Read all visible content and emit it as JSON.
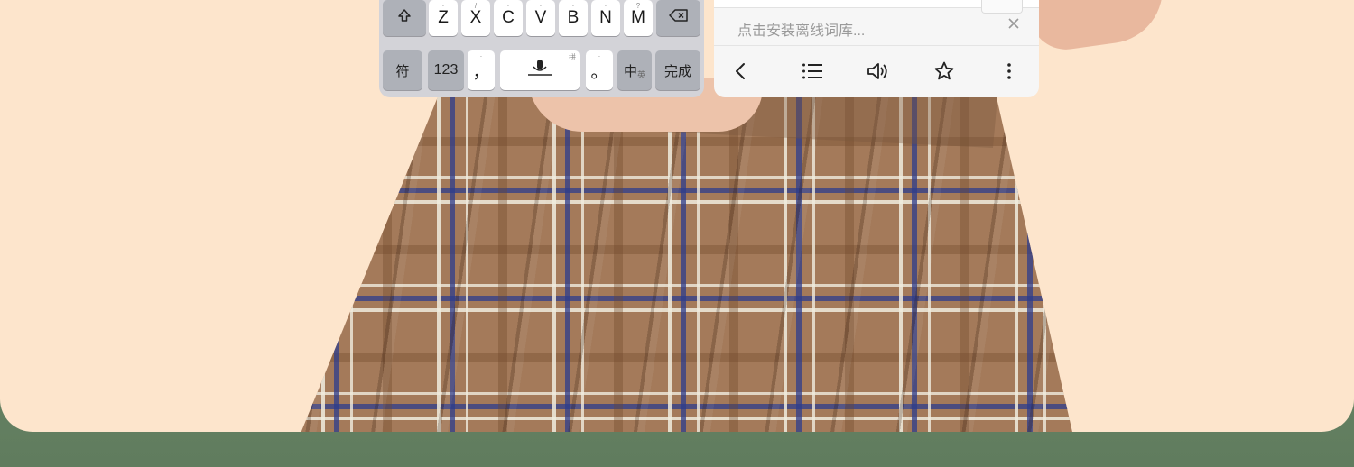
{
  "keyboard": {
    "row_letters": [
      {
        "label": "Z",
        "sup": ""
      },
      {
        "label": "X",
        "sup": ""
      },
      {
        "label": "C",
        "sup": ""
      },
      {
        "label": "V",
        "sup": ""
      },
      {
        "label": "B",
        "sup": ""
      },
      {
        "label": "N",
        "sup": ""
      },
      {
        "label": "M",
        "sup": ""
      }
    ],
    "shift_icon": "shift-icon",
    "backspace_icon": "backspace-icon",
    "symbol_key": "符",
    "num_key": "123",
    "comma_key": "，",
    "mic_icon": "microphone-icon",
    "period_key": "。",
    "lang_key": "中",
    "lang_key_sub": "英",
    "pinyin_mark": "拼",
    "done_key": "完成"
  },
  "dictionary_panel": {
    "hint": "点击安装离线词库...",
    "close_icon": "close-icon",
    "toolbar": [
      "back-icon",
      "list-icon",
      "speaker-icon",
      "star-icon",
      "more-icon"
    ]
  },
  "colors": {
    "card_bg": "#fde5cc",
    "page_bg": "#6c8868",
    "keyboard_bg": "#d3d3d8",
    "panel_bg": "#f6f6f6"
  }
}
